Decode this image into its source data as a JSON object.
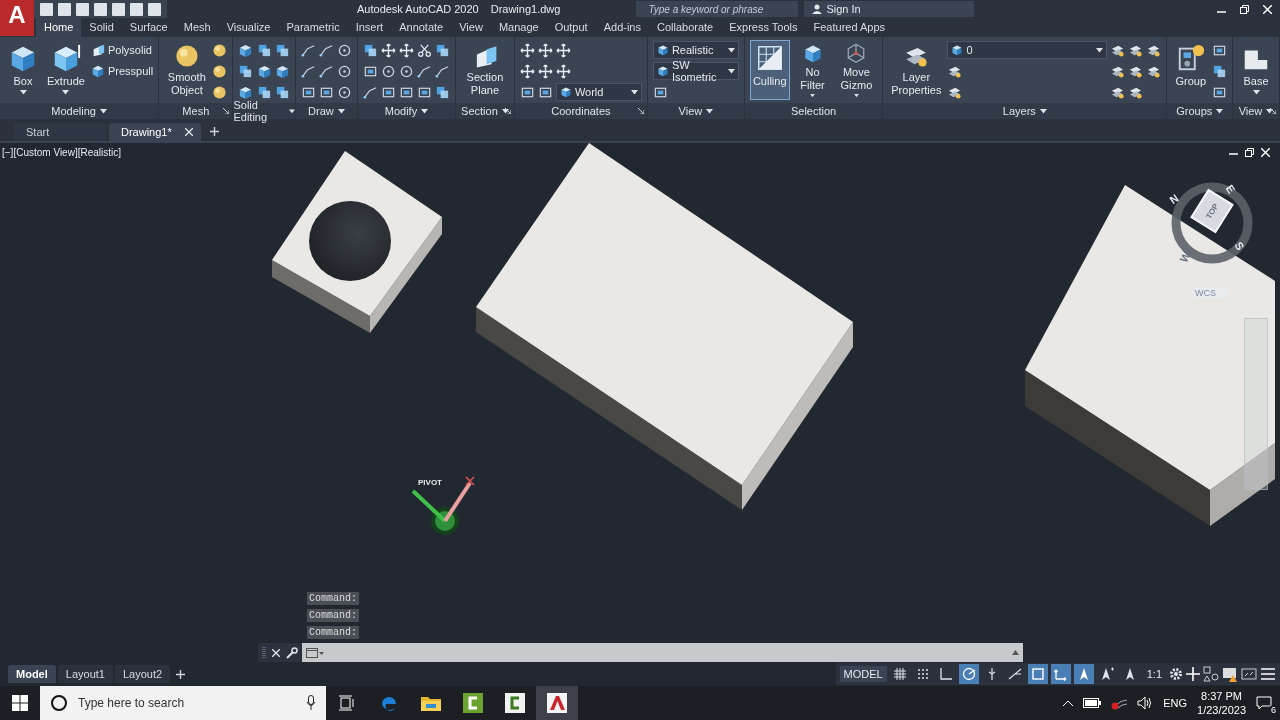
{
  "app_button": {
    "letter": "A"
  },
  "title": {
    "app": "Autodesk AutoCAD 2020",
    "document": "Drawing1.dwg"
  },
  "search": {
    "placeholder": "Type a keyword or phrase"
  },
  "account": {
    "label": "Sign In"
  },
  "ribbon_tabs": [
    {
      "label": "Home",
      "selected": true
    },
    {
      "label": "Solid",
      "selected": false
    },
    {
      "label": "Surface",
      "selected": false
    },
    {
      "label": "Mesh",
      "selected": false
    },
    {
      "label": "Visualize",
      "selected": false
    },
    {
      "label": "Parametric",
      "selected": false
    },
    {
      "label": "Insert",
      "selected": false
    },
    {
      "label": "Annotate",
      "selected": false
    },
    {
      "label": "View",
      "selected": false
    },
    {
      "label": "Manage",
      "selected": false
    },
    {
      "label": "Output",
      "selected": false
    },
    {
      "label": "Add-ins",
      "selected": false
    },
    {
      "label": "Collaborate",
      "selected": false
    },
    {
      "label": "Express Tools",
      "selected": false
    },
    {
      "label": "Featured Apps",
      "selected": false
    }
  ],
  "ribbon_panels": [
    {
      "title": "Modeling",
      "menu": true,
      "launcher": false,
      "items": [
        {
          "kind": "large",
          "label": "Box",
          "menu": true,
          "on": false
        },
        {
          "kind": "large",
          "label": "Extrude",
          "menu": true,
          "on": false
        },
        {
          "kind": "small",
          "label": "Polysolid"
        },
        {
          "kind": "small",
          "label": "Presspull"
        }
      ]
    },
    {
      "title": "Mesh",
      "menu": false,
      "launcher": true,
      "items": [
        {
          "kind": "large",
          "label": "Smooth Object",
          "menu": false,
          "on": false
        },
        {
          "kind": "icon"
        },
        {
          "kind": "icon"
        },
        {
          "kind": "icon"
        }
      ]
    },
    {
      "title": "Solid Editing",
      "menu": true,
      "launcher": false,
      "items": [
        {
          "kind": "icon"
        },
        {
          "kind": "icon"
        },
        {
          "kind": "icon"
        },
        {
          "kind": "icon"
        },
        {
          "kind": "icon"
        },
        {
          "kind": "icon"
        },
        {
          "kind": "icon"
        },
        {
          "kind": "icon"
        },
        {
          "kind": "icon"
        }
      ]
    },
    {
      "title": "Draw",
      "menu": true,
      "launcher": false,
      "items": [
        {
          "kind": "icon"
        },
        {
          "kind": "icon"
        },
        {
          "kind": "icon"
        },
        {
          "kind": "icon"
        },
        {
          "kind": "icon"
        },
        {
          "kind": "icon"
        },
        {
          "kind": "icon"
        },
        {
          "kind": "icon"
        },
        {
          "kind": "icon"
        }
      ]
    },
    {
      "title": "Modify",
      "menu": true,
      "launcher": false,
      "items": [
        {
          "kind": "icon"
        },
        {
          "kind": "icon"
        },
        {
          "kind": "icon"
        },
        {
          "kind": "icon"
        },
        {
          "kind": "icon"
        },
        {
          "kind": "icon"
        },
        {
          "kind": "icon"
        },
        {
          "kind": "icon"
        },
        {
          "kind": "icon"
        },
        {
          "kind": "icon"
        },
        {
          "kind": "icon"
        },
        {
          "kind": "icon"
        },
        {
          "kind": "icon"
        },
        {
          "kind": "icon"
        },
        {
          "kind": "icon"
        }
      ]
    },
    {
      "title": "Section",
      "menu": true,
      "launcher": true,
      "items": [
        {
          "kind": "large",
          "label": "Section Plane",
          "menu": false,
          "on": false
        }
      ]
    },
    {
      "title": "Coordinates",
      "menu": false,
      "launcher": true,
      "items": [
        {
          "kind": "icon"
        },
        {
          "kind": "icon"
        },
        {
          "kind": "icon"
        },
        {
          "kind": "icon"
        },
        {
          "kind": "icon"
        },
        {
          "kind": "icon"
        },
        {
          "kind": "icon"
        },
        {
          "kind": "icon"
        },
        {
          "kind": "dropdown",
          "label": "World"
        }
      ]
    },
    {
      "title": "View",
      "menu": true,
      "launcher": false,
      "items": [
        {
          "kind": "dropdown",
          "label": "Realistic"
        },
        {
          "kind": "dropdown",
          "label": "SW Isometric"
        },
        {
          "kind": "icon"
        }
      ]
    },
    {
      "title": "Selection",
      "menu": false,
      "launcher": false,
      "items": [
        {
          "kind": "large",
          "label": "Culling",
          "menu": false,
          "on": true
        },
        {
          "kind": "large",
          "label": "No Filter",
          "menu": true,
          "on": false
        },
        {
          "kind": "large",
          "label": "Move Gizmo",
          "menu": true,
          "on": false
        }
      ]
    },
    {
      "title": "Layers",
      "menu": true,
      "launcher": false,
      "items": [
        {
          "kind": "large",
          "label": "Layer Properties",
          "menu": false,
          "on": false
        },
        {
          "kind": "dropdown",
          "label": "0"
        },
        {
          "kind": "icon"
        },
        {
          "kind": "icon"
        },
        {
          "kind": "icon"
        },
        {
          "kind": "icon"
        },
        {
          "kind": "icon"
        },
        {
          "kind": "icon"
        },
        {
          "kind": "icon"
        },
        {
          "kind": "icon"
        },
        {
          "kind": "icon"
        },
        {
          "kind": "icon"
        }
      ]
    },
    {
      "title": "Groups",
      "menu": true,
      "launcher": false,
      "items": [
        {
          "kind": "large",
          "label": "Group",
          "menu": false,
          "on": false
        },
        {
          "kind": "icon"
        },
        {
          "kind": "icon"
        },
        {
          "kind": "icon"
        }
      ]
    },
    {
      "title": "View",
      "menu": true,
      "launcher": true,
      "items": [
        {
          "kind": "large",
          "label": "Base",
          "menu": true,
          "on": false
        }
      ]
    }
  ],
  "document_tabs": [
    {
      "label": "Start",
      "selected": false,
      "closable": false
    },
    {
      "label": "Drawing1*",
      "selected": true,
      "closable": true
    }
  ],
  "viewport": {
    "label": "[−][Custom View][Realistic]",
    "viewcube": {
      "face": "TOP",
      "directions": [
        "N",
        "E",
        "S",
        "W"
      ],
      "coordinate_system": "WCS"
    },
    "gizmo_label": "PIVOT",
    "command_history": [
      "Command:",
      "Command:",
      "Command:"
    ]
  },
  "layout_tabs": [
    {
      "label": "Model",
      "selected": true
    },
    {
      "label": "Layout1",
      "selected": false
    },
    {
      "label": "Layout2",
      "selected": false
    }
  ],
  "status_bar": {
    "space": "MODEL",
    "scale": "1:1",
    "toggles": [
      {
        "kind": "grid",
        "on": false
      },
      {
        "kind": "snap",
        "on": false
      },
      {
        "kind": "ortho",
        "on": false
      },
      {
        "kind": "polar",
        "on": true
      },
      {
        "kind": "isoplane",
        "on": false
      },
      {
        "kind": "tracking",
        "on": false
      },
      {
        "kind": "osnap",
        "on": true
      },
      {
        "kind": "ucs",
        "on": true
      },
      {
        "kind": "annotation",
        "on": true
      },
      {
        "kind": "autoscale",
        "on": false
      },
      {
        "kind": "annoscale",
        "on": false
      }
    ]
  },
  "taskbar": {
    "search_placeholder": "Type here to search",
    "language": "ENG",
    "time": "8:37 PM",
    "date": "1/23/2023",
    "notification_count": "6"
  }
}
